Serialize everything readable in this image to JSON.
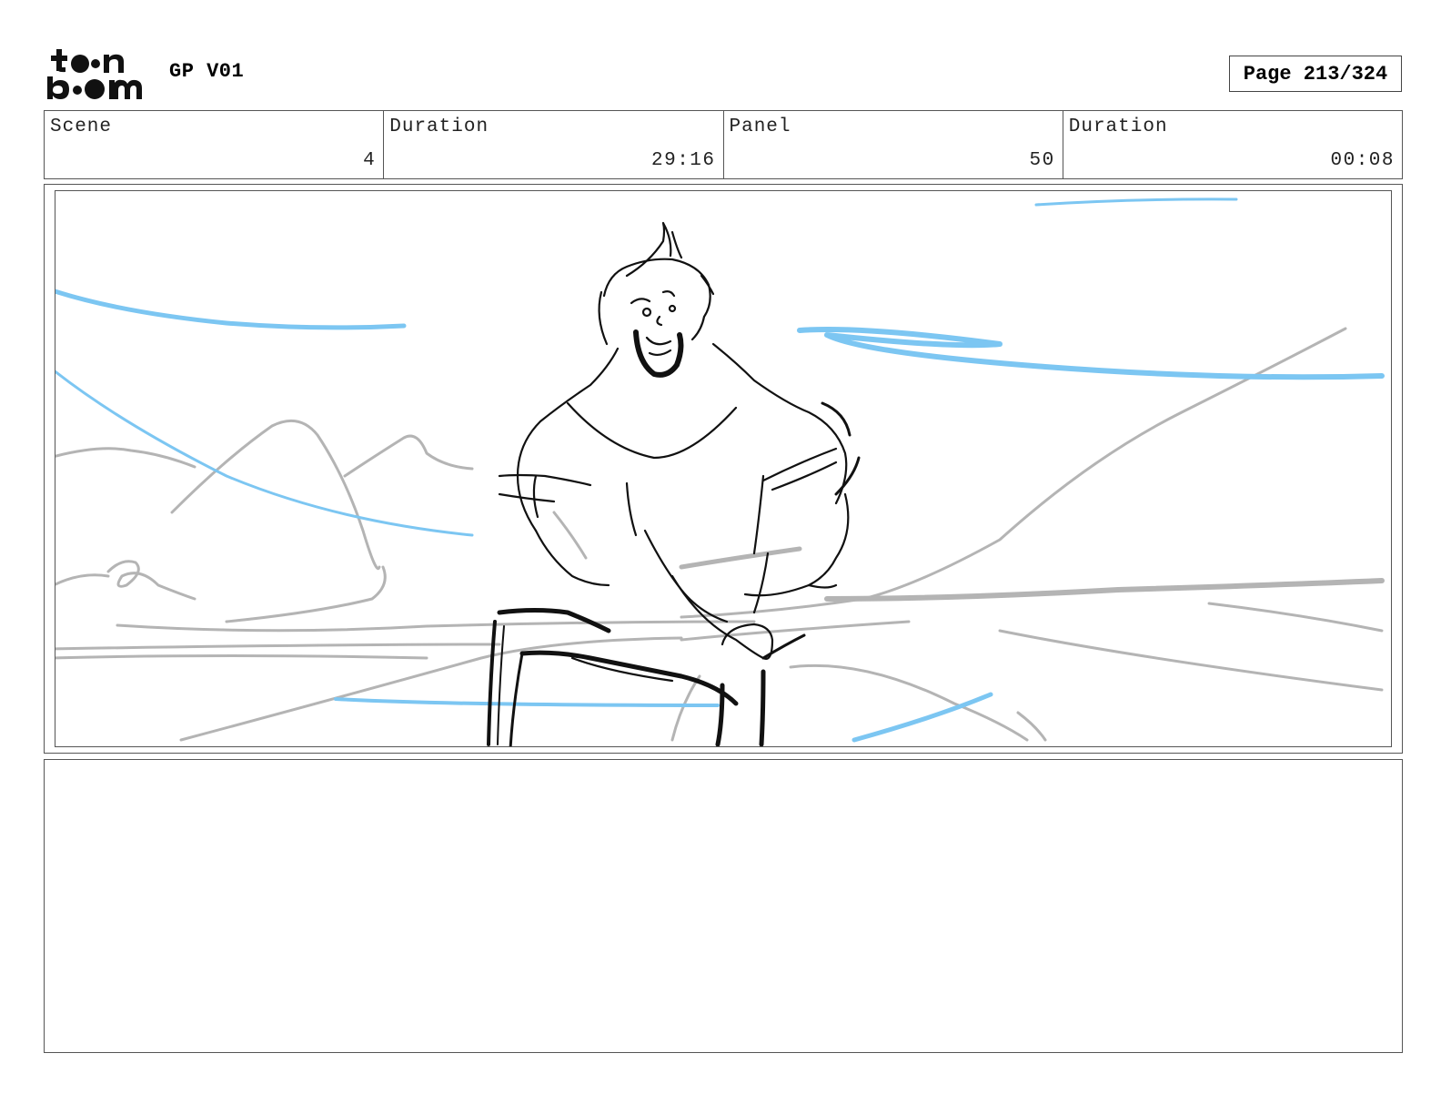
{
  "header": {
    "logo": {
      "icon": "toonboom-logo",
      "text": "toonboom"
    },
    "project_title": "GP V01",
    "page_indicator": "Page 213/324"
  },
  "info_row": [
    {
      "label": "Scene",
      "value": "4"
    },
    {
      "label": "Duration",
      "value": "29:16"
    },
    {
      "label": "Panel",
      "value": "50"
    },
    {
      "label": "Duration",
      "value": "00:08"
    }
  ],
  "panel": {
    "image": "storyboard-sketch",
    "colors": {
      "ink": "#111111",
      "background_sketch": "#b4b4b4",
      "wind_lines": "#7cc6f2"
    }
  },
  "notes": {
    "text": ""
  }
}
